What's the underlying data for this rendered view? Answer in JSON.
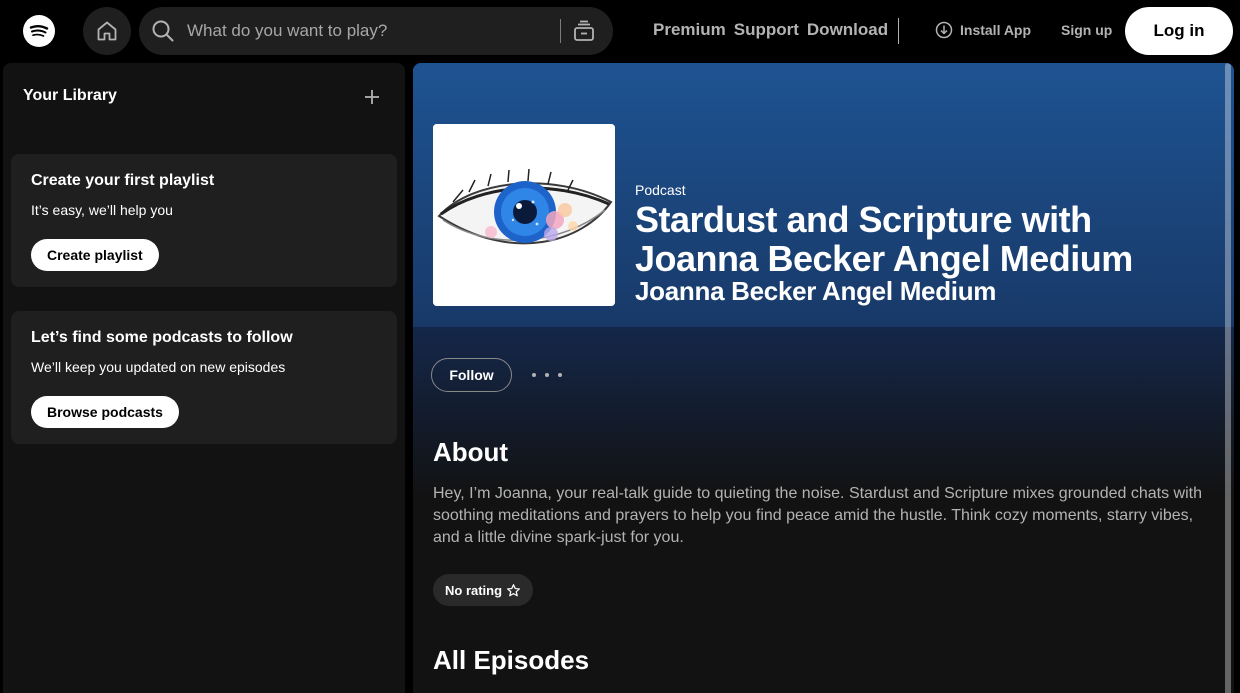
{
  "topbar": {
    "search_placeholder": "What do you want to play?",
    "nav": [
      "Premium",
      "Support",
      "Download"
    ],
    "install_label": "Install App",
    "signup_label": "Sign up",
    "login_label": "Log in"
  },
  "sidebar": {
    "title": "Your Library",
    "cards": [
      {
        "title": "Create your first playlist",
        "subtitle": "It’s easy, we’ll help you",
        "button": "Create playlist"
      },
      {
        "title": "Let’s find some podcasts to follow",
        "subtitle": "We’ll keep you updated on new episodes",
        "button": "Browse podcasts"
      }
    ]
  },
  "podcast": {
    "type_label": "Podcast",
    "title": "Stardust and Scripture with Joanna Becker Angel Medium",
    "author": "Joanna Becker Angel Medium",
    "follow_label": "Follow",
    "about_heading": "About",
    "about_text": "Hey, I’m Joanna, your real-talk guide to quieting the noise. Stardust and Scripture mixes grounded chats with soothing meditations and prayers to help you find peace amid the hustle. Think cozy moments, starry vibes, and a little divine spark-just for you.",
    "rating_label": "No rating",
    "episodes_heading": "All Episodes"
  },
  "colors": {
    "accent_blue": "#1e5392",
    "background": "#000000",
    "panel": "#121212",
    "card": "#1f1f1f"
  },
  "icons": {
    "logo": "spotify-logo-icon",
    "home": "home-icon",
    "search": "search-icon",
    "browse": "browse-icon",
    "install": "download-circle-icon",
    "add": "plus-icon",
    "more": "more-dots-icon",
    "star": "star-icon"
  }
}
